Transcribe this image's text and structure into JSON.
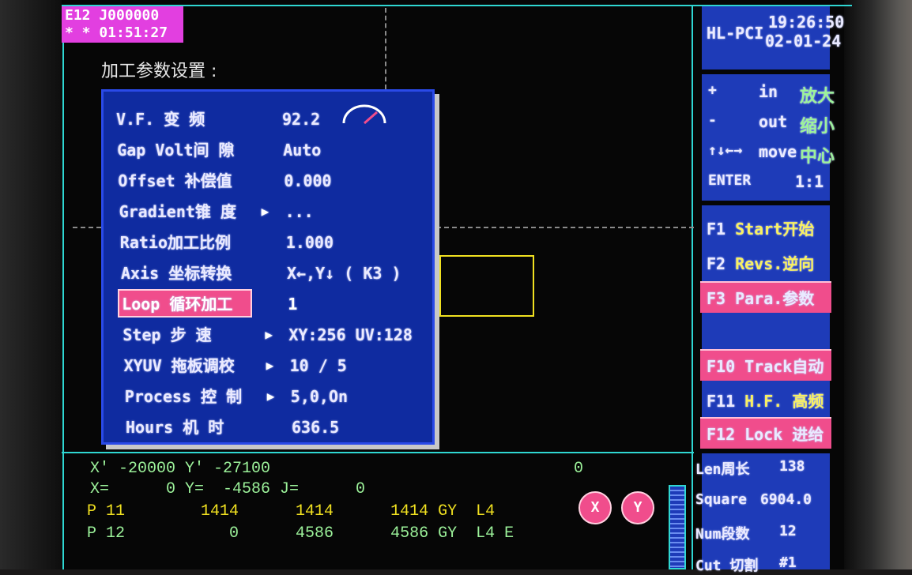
{
  "status": {
    "line1": "E12  J000000",
    "line2": "* * 01:51:27"
  },
  "params_title": "加工参数设置 :",
  "dialog": {
    "rows": [
      {
        "label": "V.F.  变  频",
        "value": "92.2",
        "arrow": ""
      },
      {
        "label": "Gap Volt间 隙",
        "value": "Auto",
        "arrow": ""
      },
      {
        "label": "Offset 补偿值",
        "value": "0.000",
        "arrow": ""
      },
      {
        "label": "Gradient锥 度",
        "value": "...",
        "arrow": "▶"
      },
      {
        "label": "Ratio加工比例",
        "value": "1.000",
        "arrow": ""
      },
      {
        "label": "Axis 坐标转换",
        "value": "X←,Y↓ ( K3 )",
        "arrow": ""
      },
      {
        "label": "Loop 循环加工",
        "value": "1",
        "arrow": ""
      },
      {
        "label": "Step  步  速",
        "value": "XY:256 UV:128",
        "arrow": "▶"
      },
      {
        "label": "XYUV 拖板调校",
        "value": "10 / 5",
        "arrow": "▶"
      },
      {
        "label": "Process 控  制",
        "value": "5,0,On",
        "arrow": "▶"
      },
      {
        "label": "Hours  机  时",
        "value": "636.5",
        "arrow": ""
      }
    ],
    "selected_index": 6
  },
  "right": {
    "title": "HL-PCI",
    "time": "19:26:50",
    "date": "02-01-24",
    "zoom": [
      {
        "key": "+",
        "cmd": "in",
        "label": "放大"
      },
      {
        "key": "-",
        "cmd": "out",
        "label": "缩小"
      },
      {
        "key": "↑↓←→",
        "cmd": "move",
        "label": "中心"
      },
      {
        "key": "ENTER",
        "cmd": "1:1",
        "label": ""
      }
    ],
    "fkeys": [
      {
        "key": "F1",
        "label": "Start开始",
        "highlight": false
      },
      {
        "key": "F2",
        "label": "Revs.逆向",
        "highlight": false
      },
      {
        "key": "F3",
        "label": "Para.参数",
        "highlight": true
      },
      {
        "key": "F10",
        "label": "Track自动",
        "highlight": true
      },
      {
        "key": "F11",
        "label": "H.F. 高频",
        "highlight": false
      },
      {
        "key": "F12",
        "label": "Lock 进给",
        "highlight": true
      }
    ],
    "stats": [
      {
        "label": "Len周长",
        "value": "138"
      },
      {
        "label": "Square",
        "value": "6904.0"
      },
      {
        "label": "Num段数",
        "value": "12"
      },
      {
        "label": "Cut 切割",
        "value": "#1"
      }
    ]
  },
  "coords": {
    "line1": "X' -20000 Y' -27100",
    "line1_right": "0",
    "line2": "X=      0 Y=  -4586 J=      0",
    "p1": "P 11        1414      1414      1414 GY  L4",
    "p2": "P 12           0      4586      4586 GY  L4 E",
    "gauge_x": "X",
    "gauge_y": "Y"
  },
  "colors": {
    "panel_blue": "#1e3bb8",
    "dialog_blue": "#0f2ba0",
    "highlight_pink": "#f04d8c",
    "status_magenta": "#e23fe0",
    "accent_cyan": "#2fd6d2",
    "coord_green": "#9cf29a",
    "coord_yellow": "#f0e020",
    "workpiece_yellow": "#f0e020"
  }
}
